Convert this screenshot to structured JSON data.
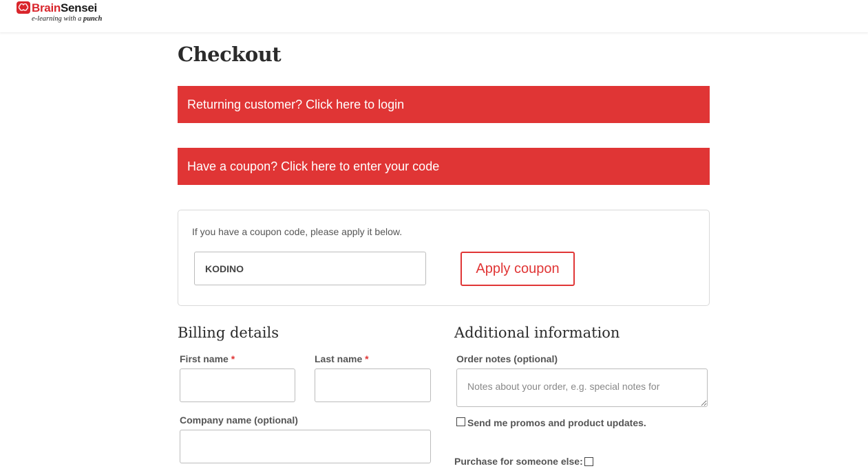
{
  "brand": {
    "name_part1": "Brain",
    "name_part2": "Sensei",
    "tagline_prefix": "e-learning with a ",
    "tagline_emphasis": "punch"
  },
  "page": {
    "title": "Checkout"
  },
  "notices": {
    "login": "Returning customer? Click here to login",
    "coupon": "Have a coupon? Click here to enter your code"
  },
  "coupon_form": {
    "hint": "If you have a coupon code, please apply it below.",
    "code_value": "KODINO",
    "apply_label": "Apply coupon"
  },
  "billing": {
    "heading": "Billing details",
    "first_name_label": "First name",
    "last_name_label": "Last name",
    "company_label": "Company name (optional)",
    "required_marker": "*"
  },
  "additional": {
    "heading": "Additional information",
    "order_notes_label": "Order notes (optional)",
    "order_notes_placeholder": "Notes about your order, e.g. special notes for",
    "promos_label": "Send me promos and product updates.",
    "someone_else_label": "Purchase for someone else:"
  },
  "colors": {
    "accent": "#e03535"
  }
}
